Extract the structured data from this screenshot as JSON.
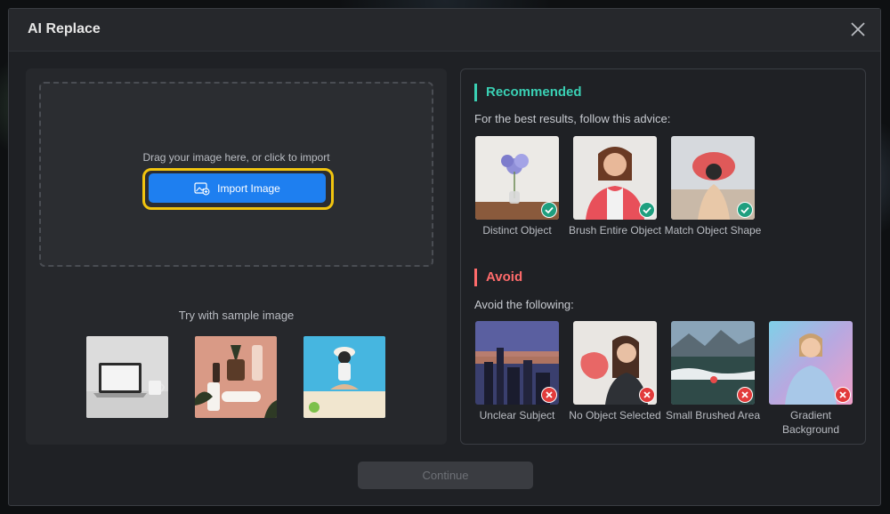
{
  "dialog": {
    "title": "AI Replace",
    "continue_label": "Continue"
  },
  "import": {
    "drop_text": "Drag your image here, or click to import",
    "button_label": "Import Image",
    "sample_title": "Try with sample image"
  },
  "recommended": {
    "title": "Recommended",
    "subtitle": "For the best results, follow this advice:",
    "items": [
      {
        "label": "Distinct Object"
      },
      {
        "label": "Brush Entire Object"
      },
      {
        "label": "Match Object Shape"
      }
    ]
  },
  "avoid": {
    "title": "Avoid",
    "subtitle": "Avoid the following:",
    "items": [
      {
        "label": "Unclear Subject"
      },
      {
        "label": "No Object Selected"
      },
      {
        "label": "Small Brushed Area"
      },
      {
        "label": "Gradient Background"
      }
    ]
  },
  "colors": {
    "accent_blue": "#1e7ff0",
    "highlight_yellow": "#f1c40f",
    "recommended_teal": "#3ad0b4",
    "avoid_red": "#ff6b6b"
  }
}
